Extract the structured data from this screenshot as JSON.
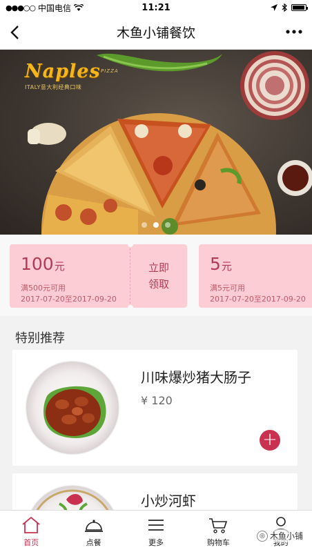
{
  "status_bar": {
    "carrier": "中国电信",
    "time": "11:21"
  },
  "nav": {
    "title": "木鱼小铺餐饮",
    "back_icon": "chevron-left-icon",
    "more_icon": "more-dots-icon"
  },
  "banner": {
    "brand": "Naples",
    "brand_sub": "PIZZA",
    "tagline": "ITALY意大利经典口味",
    "dots": 3,
    "active_dot": 1
  },
  "coupons": [
    {
      "amount": "100",
      "unit": "元",
      "condition": "满500元可用",
      "dates": "2017-07-20至2017-09-20",
      "action": "立即领取",
      "action_l1": "立即",
      "action_l2": "领取"
    },
    {
      "amount": "5",
      "unit": "元",
      "condition": "满5元可用",
      "dates": "2017-07-20至2017-09-20"
    }
  ],
  "section": {
    "title": "特别推荐"
  },
  "dishes": [
    {
      "name": "川味爆炒猪大肠子",
      "price": "¥ 120"
    },
    {
      "name": "小炒河虾"
    }
  ],
  "tabs": [
    {
      "label": "首页",
      "icon": "home-icon",
      "active": true
    },
    {
      "label": "点餐",
      "icon": "cloche-icon"
    },
    {
      "label": "更多",
      "icon": "menu-icon"
    },
    {
      "label": "购物车",
      "icon": "cart-icon"
    },
    {
      "label": "我的",
      "icon": "user-icon"
    }
  ],
  "watermark": "木鱼小铺",
  "colors": {
    "accent": "#c8314f",
    "coupon_bg": "#fccdd4",
    "coupon_text": "#b13b55",
    "brand_gold": "#f4b61b"
  }
}
